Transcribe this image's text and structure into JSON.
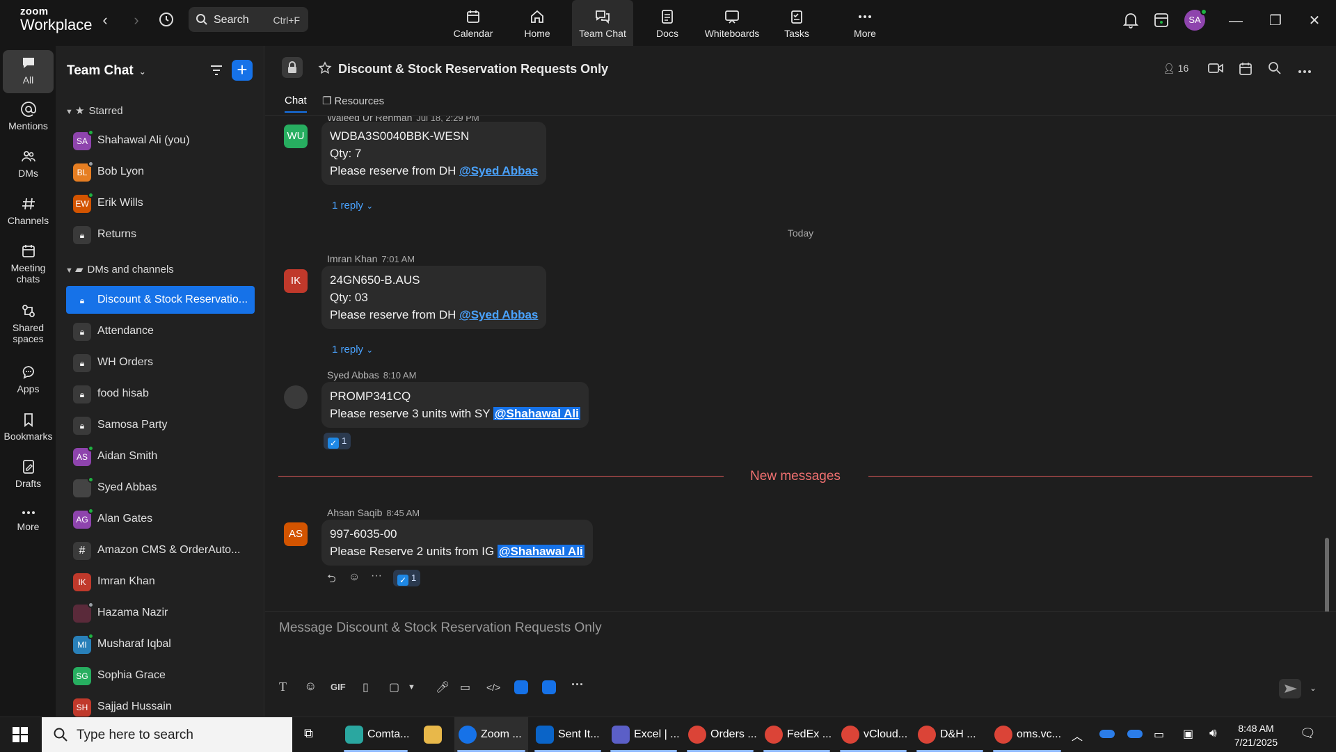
{
  "brand": {
    "line1": "zoom",
    "line2": "Workplace"
  },
  "search": {
    "label": "Search",
    "shortcut": "Ctrl+F"
  },
  "topnav": [
    {
      "label": "Calendar",
      "icon": "calendar-icon"
    },
    {
      "label": "Home",
      "icon": "home-icon"
    },
    {
      "label": "Team Chat",
      "icon": "chat-icon",
      "active": true
    },
    {
      "label": "Docs",
      "icon": "docs-icon"
    },
    {
      "label": "Whiteboards",
      "icon": "whiteboard-icon"
    },
    {
      "label": "Tasks",
      "icon": "tasks-icon"
    },
    {
      "label": "More",
      "icon": "more-icon"
    }
  ],
  "user": {
    "initials": "SA"
  },
  "rail": [
    {
      "label": "All"
    },
    {
      "label": "Mentions"
    },
    {
      "label": "DMs"
    },
    {
      "label": "Channels"
    },
    {
      "label": "Meeting chats"
    },
    {
      "label": "Shared spaces"
    },
    {
      "label": "Apps"
    },
    {
      "label": "Bookmarks"
    },
    {
      "label": "Drafts"
    },
    {
      "label": "More"
    }
  ],
  "list": {
    "title": "Team Chat",
    "starred_label": "Starred",
    "dms_label": "DMs and channels",
    "starred": [
      {
        "name": "Shahawal Ali (you)",
        "initials": "SA"
      },
      {
        "name": "Bob Lyon",
        "initials": "BL"
      },
      {
        "name": "Erik Wills",
        "initials": "EW"
      },
      {
        "name": "Returns",
        "initials": ""
      }
    ],
    "channels": [
      {
        "name": "Discount & Stock Reservatio..."
      },
      {
        "name": "Attendance"
      },
      {
        "name": "WH Orders"
      },
      {
        "name": "food hisab"
      },
      {
        "name": "Samosa Party"
      },
      {
        "name": "Aidan Smith",
        "initials": "AS"
      },
      {
        "name": "Syed Abbas",
        "initials": ""
      },
      {
        "name": "Alan Gates",
        "initials": "AG"
      },
      {
        "name": "Amazon CMS & OrderAuto...",
        "initials": "#"
      },
      {
        "name": "Imran Khan",
        "initials": "IK"
      },
      {
        "name": "Hazama Nazir",
        "initials": ""
      },
      {
        "name": "Musharaf Iqbal",
        "initials": "MI"
      },
      {
        "name": "Sophia Grace",
        "initials": "SG"
      },
      {
        "name": "Sajjad Hussain",
        "initials": "SH"
      }
    ]
  },
  "chat": {
    "title": "Discount & Stock Reservation Requests Only",
    "member_count": "16",
    "tabs": [
      "Chat",
      "Resources"
    ],
    "today_label": "Today",
    "new_messages_label": "New messages",
    "messages": [
      {
        "author": "Waleed Ur Rehman",
        "time": "Jul 18, 2:29 PM",
        "initials": "WU",
        "lines": [
          "WDBA3S0040BBK-WESN",
          "Qty: 7",
          "Please reserve from DH"
        ],
        "mention": "@Syed Abbas",
        "reply": "1 reply"
      },
      {
        "author": "Imran Khan",
        "time": "7:01 AM",
        "initials": "IK",
        "lines": [
          "24GN650-B.AUS",
          "Qty: 03",
          "Please reserve from DH"
        ],
        "mention": "@Syed Abbas",
        "reply": "1 reply"
      },
      {
        "author": "Syed Abbas",
        "time": "8:10 AM",
        "initials": "",
        "lines": [
          "PROMP341CQ",
          "Please reserve 3 units with SY"
        ],
        "mention": "@Shahawal Ali",
        "reaction": "1"
      },
      {
        "author": "Ahsan Saqib",
        "time": "8:45 AM",
        "initials": "AS",
        "lines": [
          "997-6035-00",
          "Please Reserve 2 units from IG"
        ],
        "mention": "@Shahawal Ali",
        "reaction": "1"
      }
    ],
    "composer_placeholder": "Message Discount & Stock Reservation Requests Only",
    "gif_label": "GIF"
  },
  "taskbar": {
    "search_placeholder": "Type here to search",
    "apps": [
      {
        "label": "Comta..."
      },
      {
        "label": ""
      },
      {
        "label": "Zoom ..."
      },
      {
        "label": "Sent It..."
      },
      {
        "label": "Excel | ..."
      },
      {
        "label": "Orders ..."
      },
      {
        "label": "FedEx ..."
      },
      {
        "label": "vCloud..."
      },
      {
        "label": "D&H ..."
      },
      {
        "label": "oms.vc..."
      }
    ],
    "time": "8:48 AM",
    "date": "7/21/2025"
  },
  "colors": {
    "accent": "#1672e8",
    "presence": "#1fb141",
    "new_messages": "#f07070",
    "mention": "#4aa3ff"
  }
}
